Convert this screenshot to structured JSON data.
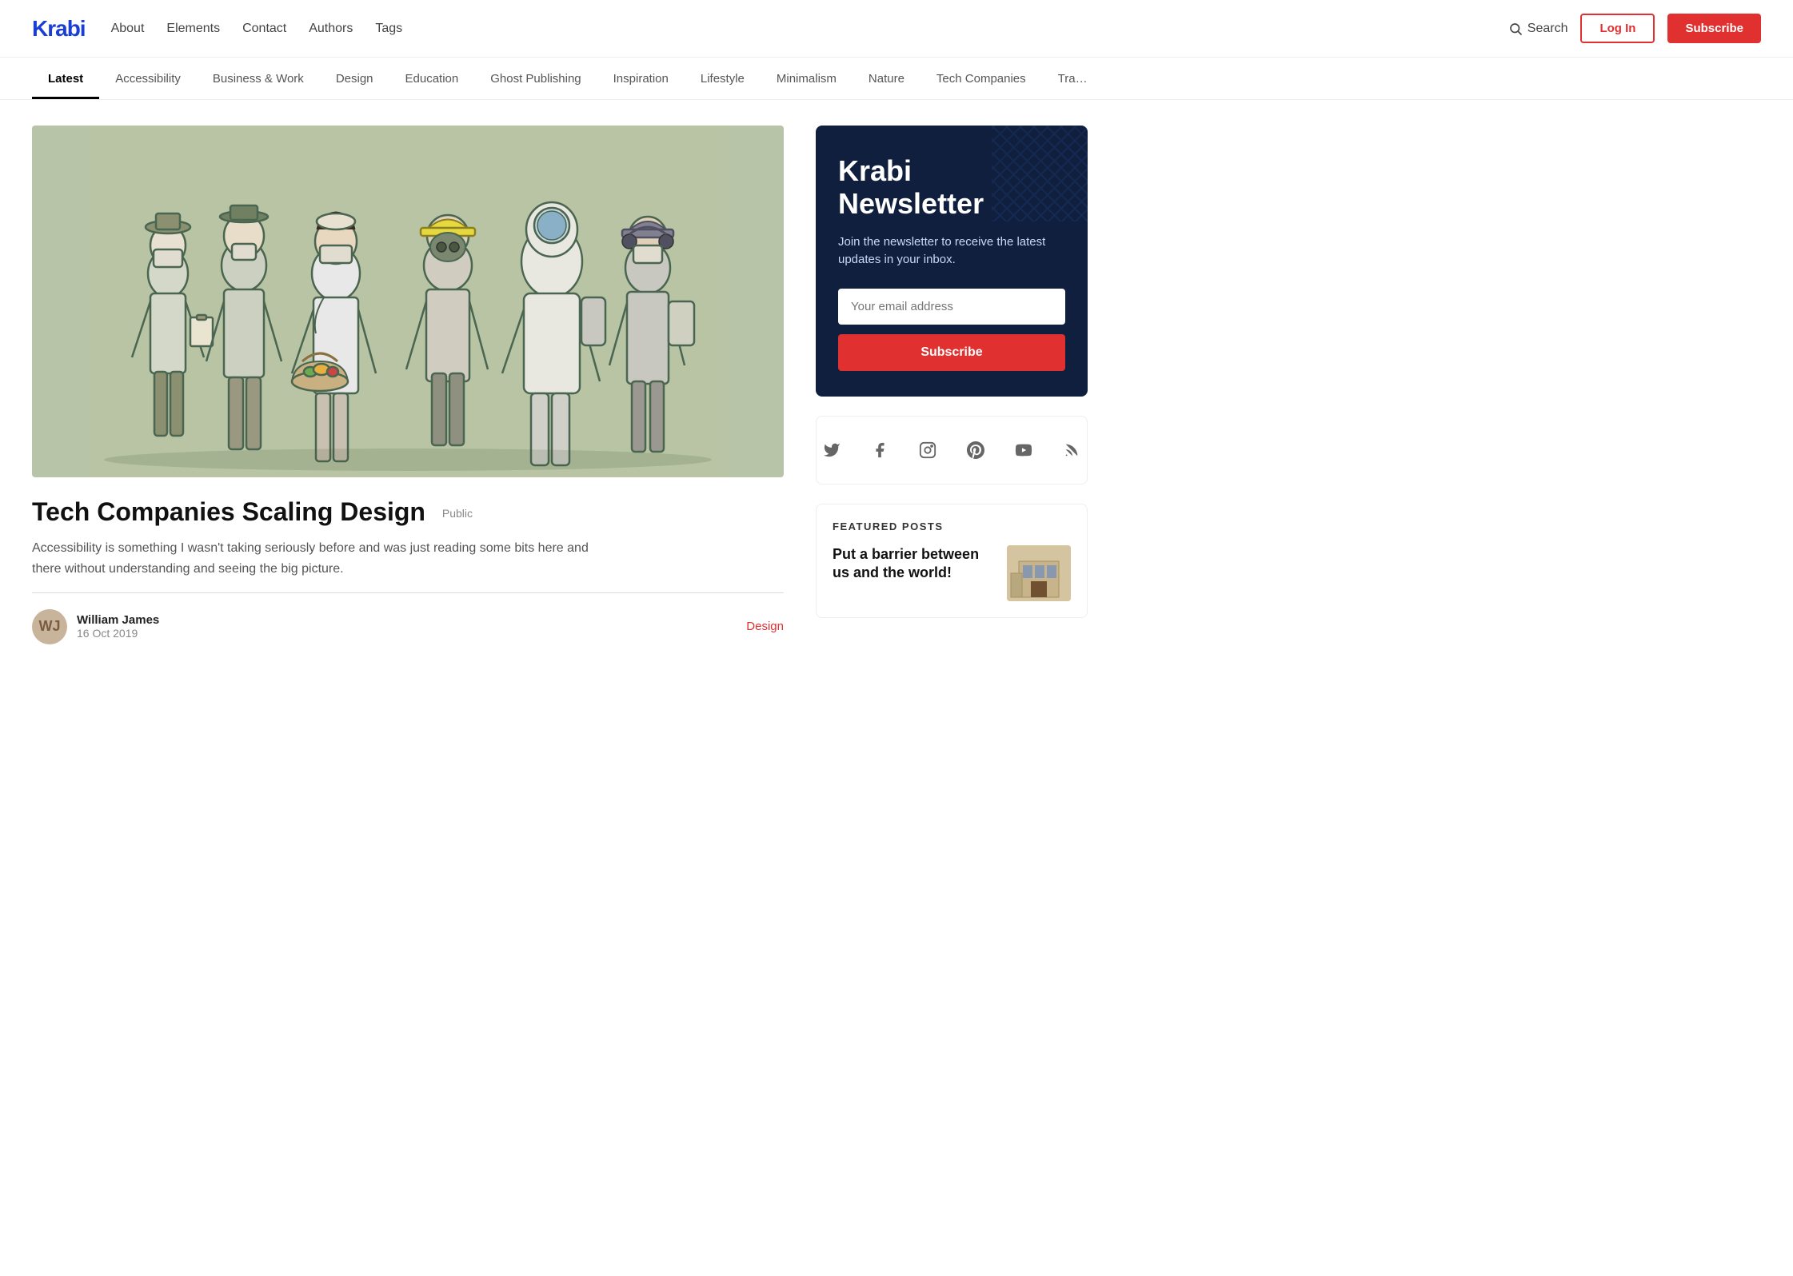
{
  "site": {
    "logo": "Krabi"
  },
  "header": {
    "nav": [
      {
        "label": "About",
        "id": "about"
      },
      {
        "label": "Elements",
        "id": "elements"
      },
      {
        "label": "Contact",
        "id": "contact"
      },
      {
        "label": "Authors",
        "id": "authors"
      },
      {
        "label": "Tags",
        "id": "tags"
      }
    ],
    "search_label": "Search",
    "login_label": "Log In",
    "subscribe_label": "Subscribe"
  },
  "categories": [
    {
      "label": "Latest",
      "active": true
    },
    {
      "label": "Accessibility"
    },
    {
      "label": "Business & Work"
    },
    {
      "label": "Design"
    },
    {
      "label": "Education"
    },
    {
      "label": "Ghost Publishing"
    },
    {
      "label": "Inspiration"
    },
    {
      "label": "Lifestyle"
    },
    {
      "label": "Minimalism"
    },
    {
      "label": "Nature"
    },
    {
      "label": "Tech Companies"
    },
    {
      "label": "Tra…"
    }
  ],
  "article": {
    "title": "Tech Companies Scaling Design",
    "badge": "Public",
    "excerpt": "Accessibility is something I wasn't taking seriously before and was just reading some bits here and there without understanding and seeing the big picture.",
    "author_name": "William James",
    "author_date": "16 Oct 2019",
    "tag": "Design",
    "author_initials": "WJ"
  },
  "newsletter": {
    "title": "Krabi Newsletter",
    "description": "Join the newsletter to receive the latest updates in your inbox.",
    "email_placeholder": "Your email address",
    "subscribe_label": "Subscribe"
  },
  "social_icons": [
    {
      "name": "twitter",
      "symbol": "𝕏"
    },
    {
      "name": "facebook",
      "symbol": "f"
    },
    {
      "name": "instagram",
      "symbol": "◻"
    },
    {
      "name": "pinterest",
      "symbol": "𝙋"
    },
    {
      "name": "youtube",
      "symbol": "▶"
    },
    {
      "name": "rss",
      "symbol": "⌘"
    }
  ],
  "featured_posts": {
    "heading": "FEATURED POSTS",
    "items": [
      {
        "title": "Put a barrier between us and the world!"
      }
    ]
  }
}
